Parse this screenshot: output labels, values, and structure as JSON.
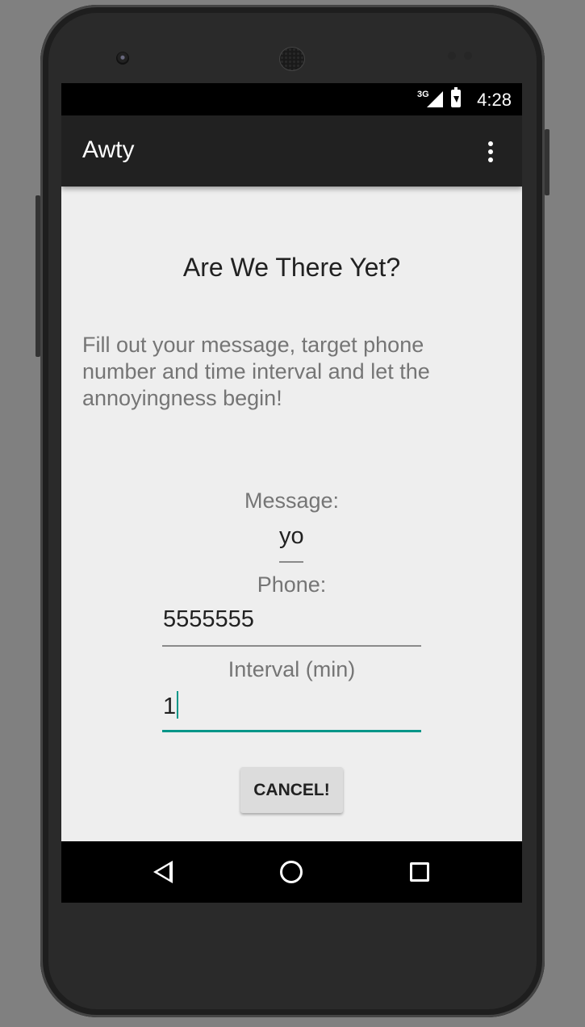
{
  "status_bar": {
    "network": "3G",
    "time": "4:28"
  },
  "app_bar": {
    "title": "Awty",
    "overflow_icon": "more-vert-icon"
  },
  "main": {
    "heading": "Are We There Yet?",
    "intro": "Fill out your message, target phone number and time interval and let the annoyingness begin!",
    "message_label": "Message:",
    "message_value": "yo",
    "phone_label": "Phone:",
    "phone_value": "5555555",
    "interval_label": "Interval (min)",
    "interval_value": "1",
    "cancel_label": "CANCEL!"
  },
  "nav_bar": {
    "icons": [
      "back-icon",
      "home-icon",
      "recents-icon"
    ]
  },
  "colors": {
    "accent": "#009688",
    "app_bar": "#212121",
    "background": "#eeeeee"
  }
}
